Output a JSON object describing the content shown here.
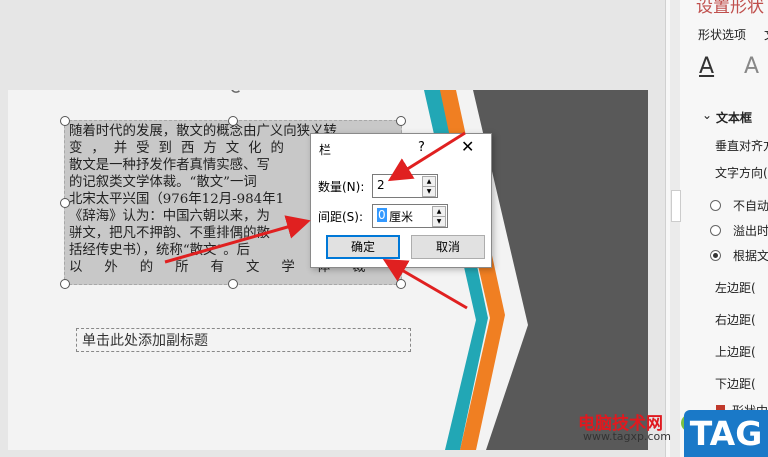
{
  "slide": {
    "text_lines": [
      "随着时代的发展，散文的概念由广义向狭义转",
      "变，并受到西方文化的",
      "散文是一种抒发作者真情实感、写",
      "的记叙类文学体裁。“散文”一词",
      "北宋太平兴国（976年12月-984年1",
      "《辞海》认为：中国六朝以来，为",
      "骈文，把凡不押韵、不重排偶的散",
      "括经传史书），统称“散文”。后",
      "以外的所有文学体裁"
    ],
    "subtitle_placeholder": "单击此处添加副标题"
  },
  "dialog": {
    "title": "栏",
    "help": "?",
    "close": "✕",
    "count_label": "数量(N):",
    "count_value": "2",
    "spacing_label": "间距(S):",
    "spacing_value": "0",
    "spacing_unit": "厘米",
    "ok": "确定",
    "cancel": "取消"
  },
  "panel": {
    "title": "设置形状",
    "tab1": "形状选项",
    "tab2": "文",
    "section": "文本框",
    "items": [
      "垂直对齐方",
      "文字方向(",
      "不自动",
      "溢出时",
      "根据文",
      "左边距(",
      "右边距(",
      "上边距(",
      "下边距(",
      "形状中"
    ]
  },
  "watermark": {
    "site_name": "电脑技术网",
    "url": "www.tagxp.com",
    "tag": "TAG"
  },
  "colors": {
    "accent": "#f07f22",
    "teal": "#22a7b5",
    "dark": "#595959",
    "arrow": "#e02020"
  }
}
